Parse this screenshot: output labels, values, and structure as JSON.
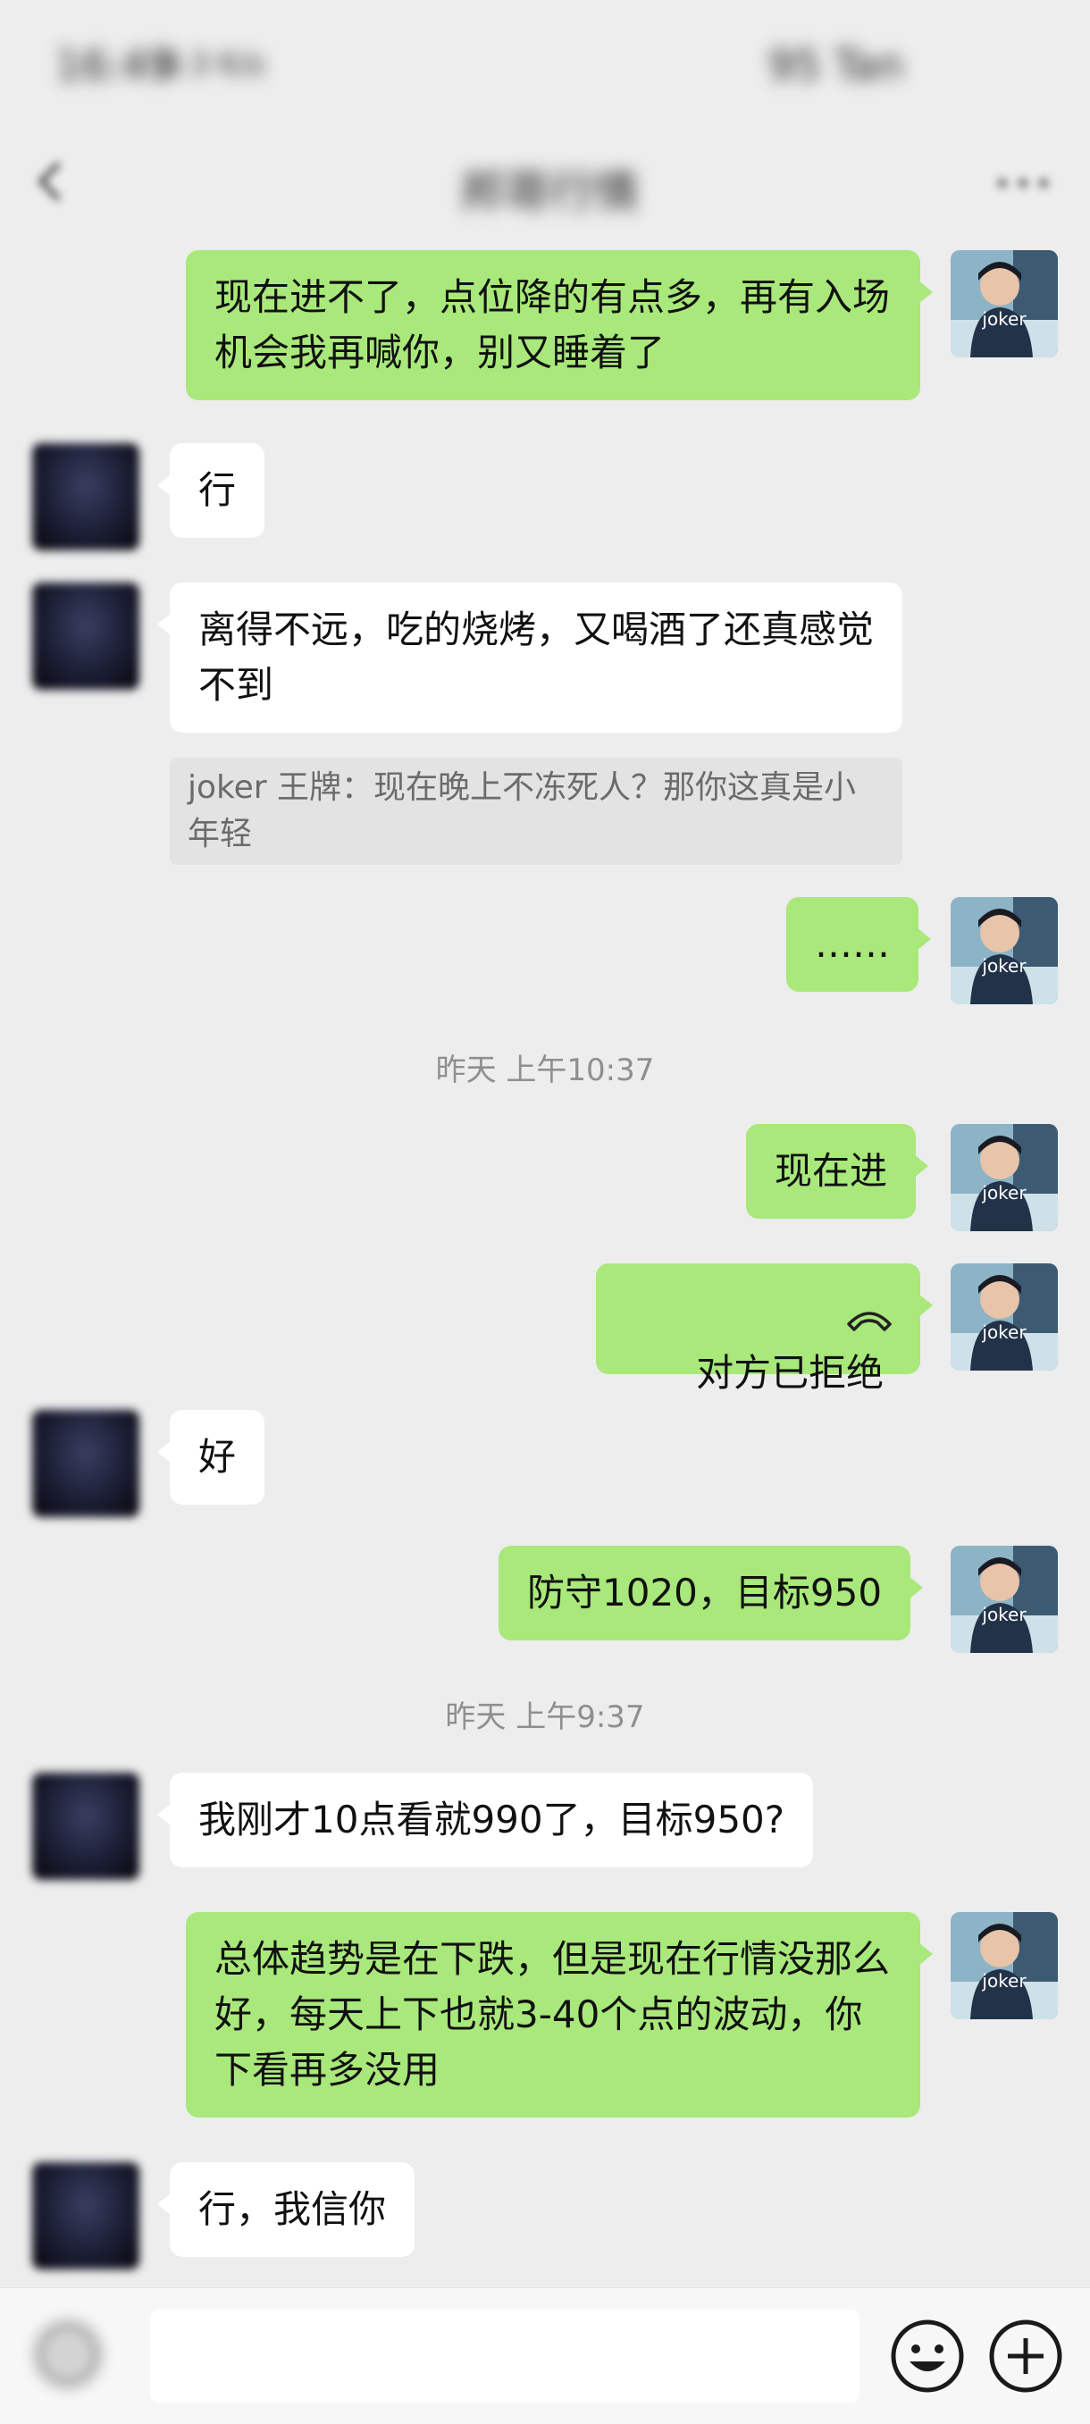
{
  "status_bar": {
    "time": "16:49",
    "info": "0.3 K/s",
    "battery": "95 Tan"
  },
  "header": {
    "title": "邦哥行情",
    "back_icon": "chevron-left-icon",
    "more_icon": "more-icon"
  },
  "avatar": {
    "me_label": "joker"
  },
  "messages": {
    "m1": "现在进不了，点位降的有点多，再有入场机会我再喊你，别又睡着了",
    "m2": "行",
    "m3": "离得不远，吃的烧烤，又喝酒了还真感觉不到",
    "m3_quote": "joker 王牌：现在晚上不冻死人？那你这真是小年轻",
    "m4": "……",
    "t1": "昨天 上午10:37",
    "m5": "现在进",
    "m6": "对方已拒绝",
    "m7": "好",
    "m8": "防守1020，目标950",
    "t2": "昨天 上午9:37",
    "m9": "我刚才10点看就990了，目标950?",
    "m10": "总体趋势是在下跌，但是现在行情没那么好，每天上下也就3-40个点的波动，你下看再多没用",
    "m11": "行，我信你"
  },
  "input": {
    "value": ""
  },
  "colors": {
    "background": "#ededed",
    "bubble_me": "#a9e87a",
    "bubble_other": "#ffffff"
  }
}
